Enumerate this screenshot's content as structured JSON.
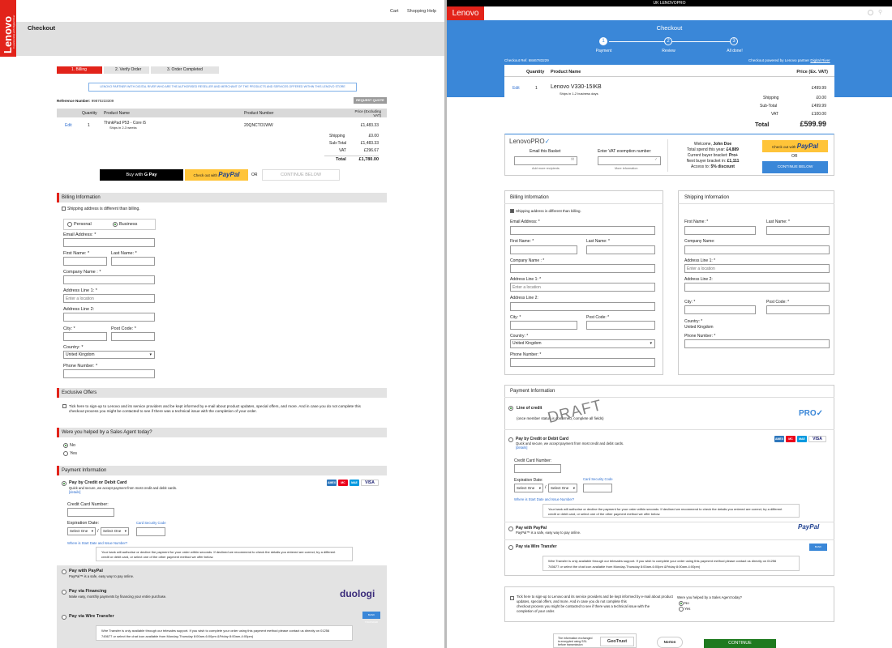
{
  "left": {
    "logo": "Lenovo",
    "logo_sub": "In partnership with Digital River",
    "top_links": [
      "Cart",
      "Shopping Help"
    ],
    "title": "Checkout",
    "steps": [
      "1. Billing",
      "2. Verify Order",
      "3. Order Completed"
    ],
    "banner": "LENOVO PARTNER WITH DIGITAL RIVER WHO ARE THE AUTHORISED RESELLER AND MERCHANT OF THE PRODUCTS AND SERVICES OFFERED WITHIN THIS LENOVO STORE",
    "reference_label": "Reference Number:",
    "reference": "99870233309",
    "request_quote": "REQUEST QUOTE",
    "table_headers": [
      "Quantity",
      "Product Name",
      "Product Number",
      "Price (Excluding VAT)"
    ],
    "row": {
      "edit": "Edit",
      "qty": "1",
      "name": "ThinkPad P53 - Core i5",
      "ships": "Ships in 2-3 weeks",
      "number": "20QNCTO1WW",
      "price": "£1,483.33"
    },
    "totals": [
      [
        "Shipping",
        "£0.00"
      ],
      [
        "Sub-Total",
        "£1,483.33"
      ],
      [
        "VAT",
        "£296.67"
      ],
      [
        "Total",
        "£1,780.00"
      ]
    ],
    "buy_with": "Buy with",
    "gpay": "G Pay",
    "paypal_prefix": "Check out with",
    "paypal": "PayPal",
    "or": "OR",
    "continue": "CONTINUE BELOW",
    "billing": {
      "title": "Billing Information",
      "ship_diff": "Shipping address is different than billing.",
      "personal": "Personal",
      "business": "Business",
      "email": "Email Address: *",
      "first": "First Name: *",
      "last": "Last Name: *",
      "company": "Company Name : *",
      "addr1": "Address Line 1: *",
      "addr1_ph": "Enter a location",
      "addr2": "Address Line 2:",
      "city": "City: *",
      "post": "Post Code: *",
      "country": "Country: *",
      "country_val": "United Kingdom",
      "phone": "Phone Number: *"
    },
    "offers": {
      "title": "Exclusive Offers",
      "text1": "Tick here to sign-up to Lenovo and its service providers and be kept informed by e-mail about product updates, special offers, and more. And in case you do not complete this",
      "text2": "checkout process you might be contacted to see if there was a technical issue with the completion of your order."
    },
    "agent": {
      "title": "Were you helped by a Sales Agent today?",
      "no": "No",
      "yes": "Yes"
    },
    "payment": {
      "title": "Payment Information",
      "card_title": "Pay by Credit or Debit Card",
      "card_sub": "Quick and secure, we accept payment from most credit and debit cards.",
      "details": "[details]",
      "cc_label": "Credit Card Number:",
      "exp_label": "Expiration Date:",
      "select": "Select One",
      "slash": "/",
      "csc": "Card Security Code",
      "start_q": "Where is Start Date and Issue Number?",
      "auth1": "Your bank will authorise or decline the payment for your order within seconds. If declined we recommend to check the details you entered are correct, try a different",
      "auth2": "credit or debit card, or select one of the other payment method we offer below.",
      "paypal_title": "Pay with PayPal",
      "paypal_sub": "PayPal™ is a safe, easy way to pay online.",
      "fin_title": "Pay via Financing",
      "fin_sub": "Make easy, monthly payments by financing your entire purchase.",
      "duologi": "duologi",
      "wire_title": "Pay via Wire Transfer",
      "wire1": "Wire Transfer is only available through our telesales support. If you wish to complete your order using this payment method please contact us directly on 01256",
      "wire2": "745677 or select the chat icon available from Monday-Thursday 8:00am-6:00pm &Friday 8:00am-4:00pm)",
      "bank": "BANK TRANSFER"
    },
    "cards": [
      "AMEX",
      "MC",
      "MAE",
      "VISA"
    ]
  },
  "right": {
    "topbar": "UK LENOVOPRO",
    "logo": "Lenovo",
    "title": "Checkout",
    "steps": [
      {
        "n": "1",
        "label": "Payment"
      },
      {
        "n": "2",
        "label": "Review"
      },
      {
        "n": "3",
        "label": "All done!"
      }
    ],
    "ref": "Checkout Ref. 6846783229",
    "powered": "Checkout powered by Lenovo partner",
    "dr": "Digital River",
    "headers": [
      "Quantity",
      "Product Name",
      "Price (Ex. VAT)"
    ],
    "row": {
      "edit": "Edit",
      "qty": "1",
      "name": "Lenovo V330-15IKB",
      "ships": "Ships in 1-2 business days",
      "price": "£499.99"
    },
    "totals": [
      [
        "Shipping",
        "£0.00"
      ],
      [
        "Sub-Total",
        "£499.99"
      ],
      [
        "VAT",
        "£100.00"
      ],
      [
        "Total",
        "£599.99"
      ]
    ],
    "pro": {
      "logo": "LenovoPRO",
      "email": "Email this Basket",
      "vat": "Enter VAT exemption number:",
      "add": "Add more recipients",
      "more": "More information",
      "welcome": "Welcome,",
      "user": "John Doe",
      "spend": "Total spend this year:",
      "spend_v": "£4,889",
      "bracket": "Current buyer bracket:",
      "bracket_v": "Pro+",
      "next": "Next buyer bracket in:",
      "next_v": "£1,111",
      "access": "Access to:",
      "access_v": "5% discount",
      "or": "OR",
      "continue": "CONTINUE BELOW",
      "paypal_prefix": "Check out with",
      "paypal": "PayPal"
    },
    "billing": {
      "title": "Billing Information",
      "ship_diff": "Shipping address is different than billing.",
      "email": "Email Address: *",
      "first": "First Name: *",
      "last": "Last Name: *",
      "company": "Company Name : *",
      "addr1": "Address Line 1: *",
      "addr1_ph": "Enter a location",
      "addr2": "Address Line 2:",
      "city": "City: *",
      "post": "Post Code: *",
      "country": "Country: *",
      "country_val": "United Kingdom",
      "phone": "Phone Number: *"
    },
    "shipping": {
      "title": "Shipping Information",
      "first": "First Name: *",
      "last": "Last Name: *",
      "company": "Company Name:",
      "addr1": "Address Line 1: *",
      "addr1_ph": "Enter a location",
      "addr2": "Address Line 2:",
      "city": "City: *",
      "post": "Post Code: *",
      "country": "Country: *",
      "country_val": "United Kingdom",
      "phone": "Phone Number: *"
    },
    "payment": {
      "title": "Payment Information",
      "loc_title": "Line of credit",
      "loc_sub": "(once member status is confirmed, complete all fields)",
      "draft": "DRAFT",
      "pro": "PRO",
      "card_title": "Pay by Credit or Debit Card",
      "card_sub": "Quick and secure, we accept payment from most credit and debit cards.",
      "details": "[details]",
      "cc_label": "Credit Card Number:",
      "exp_label": "Expiration Date:",
      "select": "Select One",
      "slash": "/",
      "csc": "Card Security Code",
      "start_q": "Where is Start Date and Issue Number?",
      "auth1": "Your bank will authorise or decline the payment for your order within seconds. If declined we recommend to check the details you entered are correct, try a different",
      "auth2": "credit or debit card, or select one of the other payment method we offer below.",
      "paypal_title": "Pay with PayPal",
      "paypal_sub": "PayPal™ is a safe, easy way to pay online.",
      "paypal": "PayPal",
      "wire_title": "Pay via Wire Transfer",
      "wire1": "Wire Transfer is only available through our telesales support. If you wish to complete your order using this payment method please contact us directly on 01256",
      "wire2": "745677 or select the chat icon available from Monday-Thursday 8:00am-6:00pm &Friday 8:00am-4:00pm)",
      "bank": "BANK TRANSFER"
    },
    "consent1": "Tick here to sign-up to Lenovo and its service providers and be kept informed by e-mail about product",
    "consent2": "updates, special offers, and more. And in case you do not complete this",
    "consent3": "checkout process you might be contacted to see if there was a technical issue with the",
    "consent4": "completion of your order.",
    "agent": {
      "title": "Were you helped by a Sales Agent today?",
      "no": "No",
      "yes": "Yes"
    },
    "trust1": "The information exchanged",
    "trust2": "is encrypted using SSL",
    "trust3": "before transmission",
    "geotrust": "GeoTrust",
    "norton": "Norton",
    "continue": "CONTINUE",
    "cards": [
      "AMEX",
      "MC",
      "MAE",
      "VISA"
    ]
  },
  "colors": {
    "lenovo_red": "#e2231a",
    "blue": "#3a87d8",
    "paypal_yellow": "#ffc439",
    "green": "#1f7a1f"
  }
}
